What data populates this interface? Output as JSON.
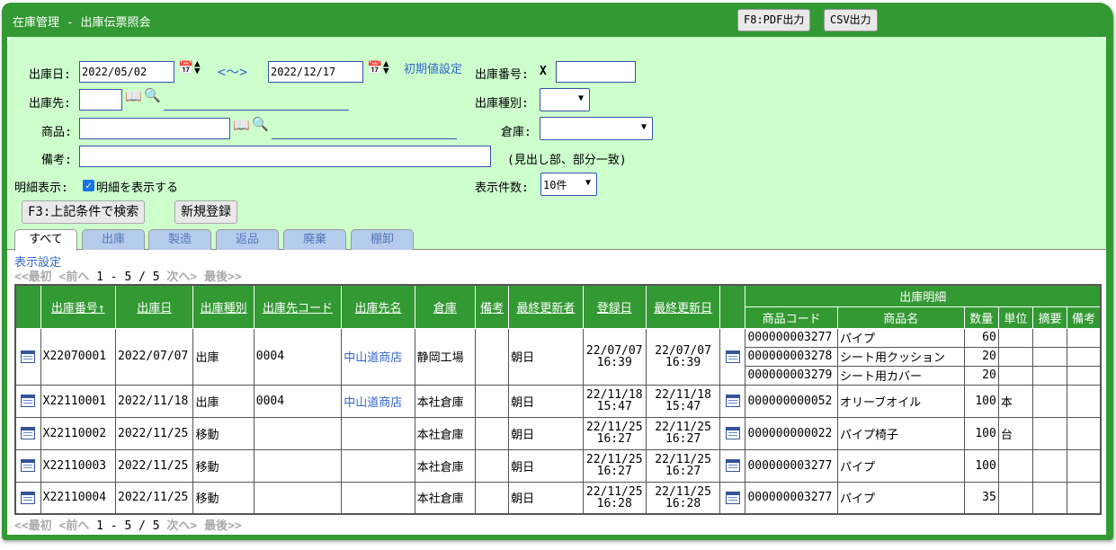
{
  "window": {
    "title": "在庫管理 - 出庫伝票照会",
    "pdf_button": "F8:PDF出力",
    "csv_button": "CSV出力"
  },
  "search": {
    "date_label": "出庫日:",
    "date_from": "2022/05/02",
    "range_sep": "<～>",
    "date_to": "2022/12/17",
    "init_link": "初期値設定",
    "slip_no_label": "出庫番号:",
    "slip_no_prefix": "X",
    "slip_no_value": "",
    "dest_label": "出庫先:",
    "dest_value": "",
    "type_label": "出庫種別:",
    "type_value": "",
    "product_label": "商品:",
    "product_value": "",
    "warehouse_label": "倉庫:",
    "warehouse_value": "",
    "note_label": "備考:",
    "note_value": "",
    "note_hint": "(見出し部、部分一致)",
    "detail_label": "明細表示:",
    "detail_checkbox_label": "明細を表示する",
    "detail_checked": true,
    "count_label": "表示件数:",
    "count_value": "10件",
    "search_button": "F3:上記条件で検索",
    "new_button": "新規登録"
  },
  "tabs": [
    "すべて",
    "出庫",
    "製造",
    "返品",
    "廃棄",
    "棚卸"
  ],
  "settings_link": "表示設定",
  "pager": {
    "first": "<<最初",
    "prev": "<前へ",
    "range": "1 - 5 / 5",
    "next": "次へ>",
    "last": "最後>>"
  },
  "table": {
    "headers": [
      "出庫番号↑",
      "出庫日",
      "出庫種別",
      "出庫先コード",
      "出庫先名",
      "倉庫",
      "備考",
      "最終更新者",
      "登録日",
      "最終更新日"
    ],
    "detail_group": "出庫明細",
    "detail_headers": [
      "商品コード",
      "商品名",
      "数量",
      "単位",
      "摘要",
      "備考"
    ],
    "rows": [
      {
        "no": "X22070001",
        "date": "2022/07/07",
        "type": "出庫",
        "dest_code": "0004",
        "dest_name": "中山道商店",
        "warehouse": "静岡工場",
        "note": "",
        "updater": "朝日",
        "reg_date": "22/07/07",
        "reg_time": "16:39",
        "upd_date": "22/07/07",
        "upd_time": "16:39",
        "details": [
          {
            "code": "000000003277",
            "name": "パイプ",
            "qty": "60",
            "unit": ""
          },
          {
            "code": "000000003278",
            "name": "シート用クッション",
            "qty": "20",
            "unit": ""
          },
          {
            "code": "000000003279",
            "name": "シート用カバー",
            "qty": "20",
            "unit": ""
          }
        ]
      },
      {
        "no": "X22110001",
        "date": "2022/11/18",
        "type": "出庫",
        "dest_code": "0004",
        "dest_name": "中山道商店",
        "warehouse": "本社倉庫",
        "note": "",
        "updater": "朝日",
        "reg_date": "22/11/18",
        "reg_time": "15:47",
        "upd_date": "22/11/18",
        "upd_time": "15:47",
        "details": [
          {
            "code": "000000000052",
            "name": "オリーブオイル",
            "qty": "100",
            "unit": "本"
          }
        ]
      },
      {
        "no": "X22110002",
        "date": "2022/11/25",
        "type": "移動",
        "dest_code": "",
        "dest_name": "",
        "warehouse": "本社倉庫",
        "note": "",
        "updater": "朝日",
        "reg_date": "22/11/25",
        "reg_time": "16:27",
        "upd_date": "22/11/25",
        "upd_time": "16:27",
        "details": [
          {
            "code": "000000000022",
            "name": "パイプ椅子",
            "qty": "100",
            "unit": "台"
          }
        ]
      },
      {
        "no": "X22110003",
        "date": "2022/11/25",
        "type": "移動",
        "dest_code": "",
        "dest_name": "",
        "warehouse": "本社倉庫",
        "note": "",
        "updater": "朝日",
        "reg_date": "22/11/25",
        "reg_time": "16:27",
        "upd_date": "22/11/25",
        "upd_time": "16:27",
        "details": [
          {
            "code": "000000003277",
            "name": "パイプ",
            "qty": "100",
            "unit": ""
          }
        ]
      },
      {
        "no": "X22110004",
        "date": "2022/11/25",
        "type": "移動",
        "dest_code": "",
        "dest_name": "",
        "warehouse": "本社倉庫",
        "note": "",
        "updater": "朝日",
        "reg_date": "22/11/25",
        "reg_time": "16:28",
        "upd_date": "22/11/25",
        "upd_time": "16:28",
        "details": [
          {
            "code": "000000003277",
            "name": "パイプ",
            "qty": "35",
            "unit": ""
          }
        ]
      }
    ]
  }
}
